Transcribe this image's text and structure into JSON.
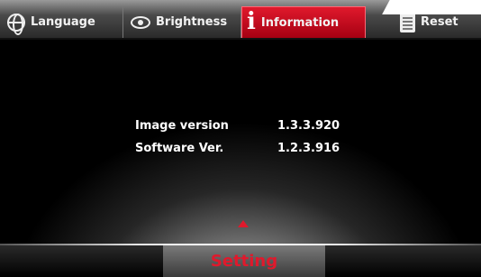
{
  "tabs": [
    {
      "label": "Language",
      "icon": "globe-icon",
      "active": false
    },
    {
      "label": "Brightness",
      "icon": "eye-icon",
      "active": false
    },
    {
      "label": "Information",
      "icon": "info-icon",
      "active": true
    },
    {
      "label": "Reset",
      "icon": "document-icon",
      "active": false
    }
  ],
  "info": {
    "image_version_label": "Image version",
    "image_version_value": "1.3.3.920",
    "software_version_label": "Software Ver.",
    "software_version_value": "1.2.3.916"
  },
  "footer": {
    "setting_label": "Setting"
  },
  "colors": {
    "accent": "#e0192c",
    "background": "#000000",
    "text": "#ffffff"
  }
}
